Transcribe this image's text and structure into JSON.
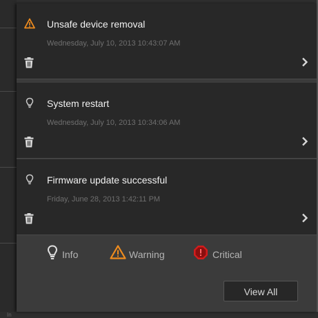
{
  "notifications": [
    {
      "type": "warning",
      "icon": "warning-triangle-icon",
      "title": "Unsafe device removal",
      "timestamp": "Wednesday, July 10, 2013 10:43:07 AM"
    },
    {
      "type": "info",
      "icon": "lightbulb-icon",
      "title": "System restart",
      "timestamp": "Wednesday, July 10, 2013 10:34:06 AM"
    },
    {
      "type": "info",
      "icon": "lightbulb-icon",
      "title": "Firmware update successful",
      "timestamp": "Friday, June 28, 2013 1:42:11 PM"
    }
  ],
  "legend": {
    "info_label": "Info",
    "warning_label": "Warning",
    "critical_label": "Critical"
  },
  "view_all_label": "View All",
  "background": {
    "bottom_text": "In"
  },
  "colors": {
    "warning": "#f08c1e",
    "critical": "#d41c1c",
    "panel": "#282828",
    "footer": "#3b3b3b",
    "text": "#f2f2f2",
    "timestamp": "#6f6f6f"
  }
}
